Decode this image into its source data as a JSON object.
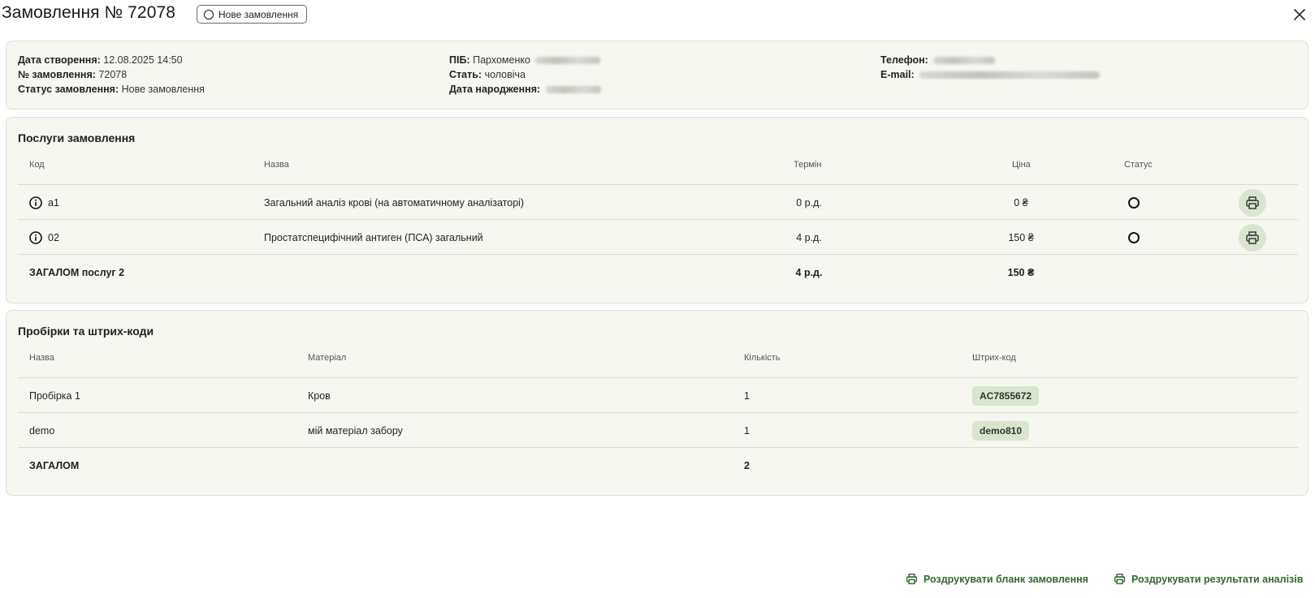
{
  "header": {
    "title": "Замовлення № 72078",
    "status_label": "Нове замовлення"
  },
  "info": {
    "created_label": "Дата створення:",
    "created_value": "12.08.2025 14:50",
    "number_label": "№ замовлення:",
    "number_value": "72078",
    "status_label": "Статус замовлення:",
    "status_value": "Нове замовлення",
    "name_label": "ПІБ:",
    "name_value": "Пархоменко",
    "gender_label": "Стать:",
    "gender_value": "чоловіча",
    "birth_label": "Дата народження:",
    "phone_label": "Телефон:",
    "email_label": "E-mail:"
  },
  "services": {
    "title": "Послуги замовлення",
    "columns": {
      "code": "Код",
      "name": "Назва",
      "term": "Термін",
      "price": "Ціна",
      "status": "Статус"
    },
    "rows": [
      {
        "code": "а1",
        "name": "Загальний аналіз крові (на автоматичному аналізаторі)",
        "term": "0 р.д.",
        "price": "0 ₴"
      },
      {
        "code": "02",
        "name": "Простатспецифічний антиген (ПСА) загальний",
        "term": "4 р.д.",
        "price": "150 ₴"
      }
    ],
    "total": {
      "label": "ЗАГАЛОМ послуг 2",
      "term": "4 р.д.",
      "price": "150 ₴"
    }
  },
  "tubes": {
    "title": "Пробірки та штрих-коди",
    "columns": {
      "name": "Назва",
      "material": "Матеріал",
      "quantity": "Кількість",
      "barcode": "Штрих-код"
    },
    "rows": [
      {
        "name": "Пробірка 1",
        "material": "Кров",
        "quantity": "1",
        "barcode": "AC7855672"
      },
      {
        "name": "demo",
        "material": "мій матеріал забору",
        "quantity": "1",
        "barcode": "demo810"
      }
    ],
    "total": {
      "label": "ЗАГАЛОМ",
      "quantity": "2"
    }
  },
  "footer": {
    "print_order": "Роздрукувати бланк замовлення",
    "print_results": "Роздрукувати результати аналізів"
  },
  "colors": {
    "accent": "#2e6e26",
    "card_bg": "#f7f7f2",
    "chip_bg": "#d8e6cd"
  },
  "icons": [
    "close-icon",
    "info-icon",
    "printer-icon",
    "status-circle-icon"
  ]
}
